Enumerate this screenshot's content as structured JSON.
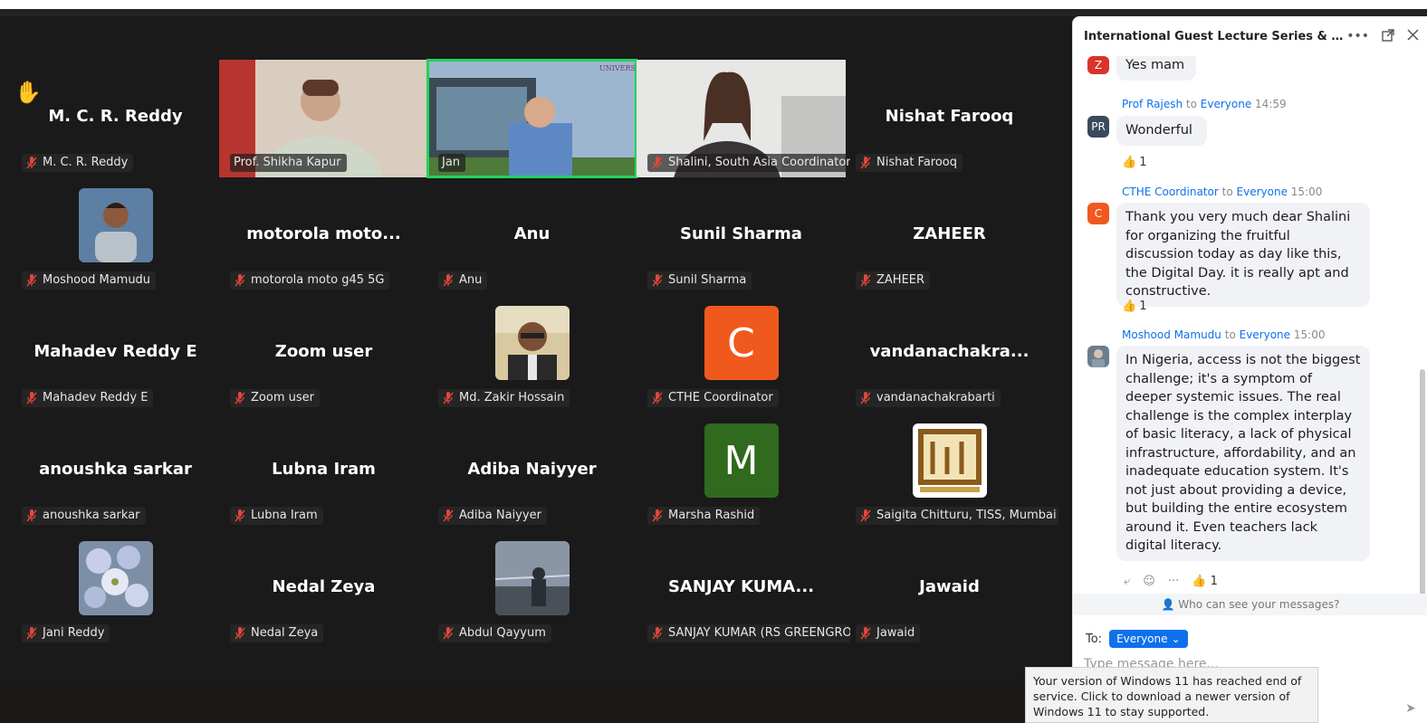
{
  "chat": {
    "title": "International Guest Lecture Series & Other A...",
    "messages": [
      {
        "avatar": "Z",
        "avatar_color": "#d9342b",
        "text": "Yes mam"
      },
      {
        "avatar": "PR",
        "avatar_color": "#3a4a5c",
        "from": "Prof Rajesh",
        "to": "Everyone",
        "time": "14:59",
        "text": "Wonderful",
        "reaction_count": "1"
      },
      {
        "avatar": "C",
        "avatar_color": "#f0591e",
        "from": "CTHE Coordinator",
        "to": "Everyone",
        "time": "15:00",
        "text": "Thank you very much dear Shalini for organizing the fruitful discussion today as day like this, the Digital Day. it is really apt and constructive.",
        "reaction_count": "1"
      },
      {
        "avatar": "",
        "avatar_color": "#6b7d8f",
        "from": "Moshood Mamudu",
        "to": "Everyone",
        "time": "15:00",
        "text": "In Nigeria, access is not the biggest challenge; it's a symptom of deeper systemic issues. The real challenge is the complex interplay of basic literacy, a lack of physical infrastructure, affordability, and an inadequate education system. It's not just about providing a device, but building the entire ecosystem around it. Even teachers lack digital literacy.",
        "reaction_count": "1"
      }
    ],
    "to_word": "to",
    "who_can_see": "Who can see your messages?",
    "to_label": "To:",
    "to_value": "Everyone",
    "input_placeholder": "Type message here..."
  },
  "participants": [
    {
      "big": "M. C. R. Reddy",
      "label": "M. C. R. Reddy"
    },
    {
      "label": "Prof. Shikha Kapur",
      "video": true
    },
    {
      "label": "Jan",
      "video": true,
      "active": true
    },
    {
      "label": "Shalini, South Asia Coordinator, A...",
      "video": true
    },
    {
      "big": "Nishat Farooq",
      "label": "Nishat Farooq"
    },
    {
      "label": "Moshood Mamudu",
      "avatar": "photo"
    },
    {
      "big": "motorola moto...",
      "label": "motorola moto g45 5G"
    },
    {
      "big": "Anu",
      "label": "Anu"
    },
    {
      "big": "Sunil Sharma",
      "label": "Sunil Sharma"
    },
    {
      "big": "ZAHEER",
      "label": "ZAHEER"
    },
    {
      "big": "Mahadev Reddy E",
      "label": "Mahadev Reddy E"
    },
    {
      "big": "Zoom user",
      "label": "Zoom user"
    },
    {
      "label": "Md. Zakir Hossain",
      "avatar": "photo"
    },
    {
      "label": "CTHE Coordinator",
      "letter": "C",
      "letter_color": "#f0591e"
    },
    {
      "big": "vandanachakra...",
      "label": "vandanachakrabarti"
    },
    {
      "big": "anoushka sarkar",
      "label": "anoushka sarkar"
    },
    {
      "big": "Lubna Iram",
      "label": "Lubna Iram"
    },
    {
      "big": "Adiba Naiyyer",
      "label": "Adiba Naiyyer"
    },
    {
      "label": "Marsha Rashid",
      "letter": "M",
      "letter_color": "#2f6a1f"
    },
    {
      "label": "Saigita Chitturu, TISS, Mumbai",
      "avatar": "logo"
    },
    {
      "label": "Jani Reddy",
      "avatar": "flowers"
    },
    {
      "big": "Nedal Zeya",
      "label": "Nedal Zeya"
    },
    {
      "label": "Abdul Qayyum",
      "avatar": "photo"
    },
    {
      "big": "SANJAY KUMA...",
      "label": "SANJAY KUMAR (RS GREENGROW)"
    },
    {
      "big": "Jawaid",
      "label": "Jawaid"
    }
  ],
  "toast": {
    "text": "Your version of Windows 11 has reached end of service. Click to download a newer version of Windows 11 to stay supported."
  },
  "icons": {
    "raise_hand": "raised-hand-icon",
    "mute": "mic-off-icon",
    "more": "more-icon",
    "popout": "popout-icon",
    "close": "close-icon",
    "thumbs_up": "thumbs-up-icon"
  }
}
